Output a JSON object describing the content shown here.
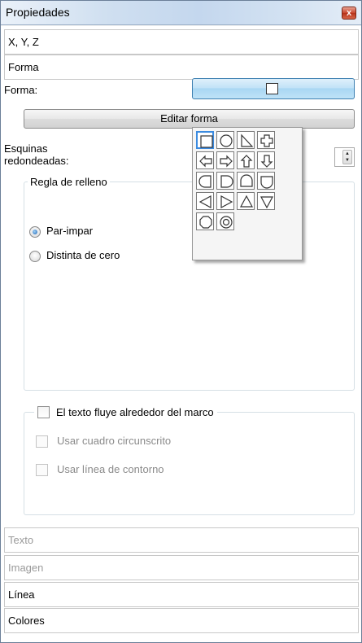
{
  "window": {
    "title": "Propiedades",
    "close_glyph": "x"
  },
  "sections_top": [
    {
      "label": "X, Y, Z"
    },
    {
      "label": "Forma"
    }
  ],
  "shape": {
    "label": "Forma:",
    "edit_button": "Editar forma",
    "palette_icons": [
      "rectangle-icon",
      "ellipse-icon",
      "right-triangle-icon",
      "cross-icon",
      "arrow-left-icon",
      "arrow-right-icon",
      "arrow-up-icon",
      "arrow-down-icon",
      "half-round-left-icon",
      "half-round-right-icon",
      "half-round-top-icon",
      "half-round-bottom-icon",
      "triangle-left-icon",
      "triangle-right-icon",
      "triangle-up-icon",
      "triangle-down-icon",
      "octagon-icon",
      "ring-icon"
    ]
  },
  "corners": {
    "label": "Esquinas redondeadas:",
    "label_line1": "Esquinas",
    "label_line2": "redondeadas:"
  },
  "fill_rule": {
    "legend": "Regla de relleno",
    "options": [
      {
        "label": "Par-impar",
        "checked": true
      },
      {
        "label": "Distinta de cero",
        "checked": false
      }
    ]
  },
  "text_flow": {
    "label": "El texto fluye alrededor del marco",
    "checked": false,
    "options": [
      {
        "label": "Usar cuadro circunscrito",
        "enabled": false
      },
      {
        "label": "Usar línea de contorno",
        "enabled": false
      }
    ]
  },
  "sections_bottom": [
    {
      "label": "Texto",
      "enabled": false
    },
    {
      "label": "Imagen",
      "enabled": false
    },
    {
      "label": "Línea",
      "enabled": true
    },
    {
      "label": "Colores",
      "enabled": true
    }
  ],
  "colors": {
    "accent": "#3b8be0",
    "disabled_text": "#9a9a9a",
    "close_button": "#c8442c"
  }
}
